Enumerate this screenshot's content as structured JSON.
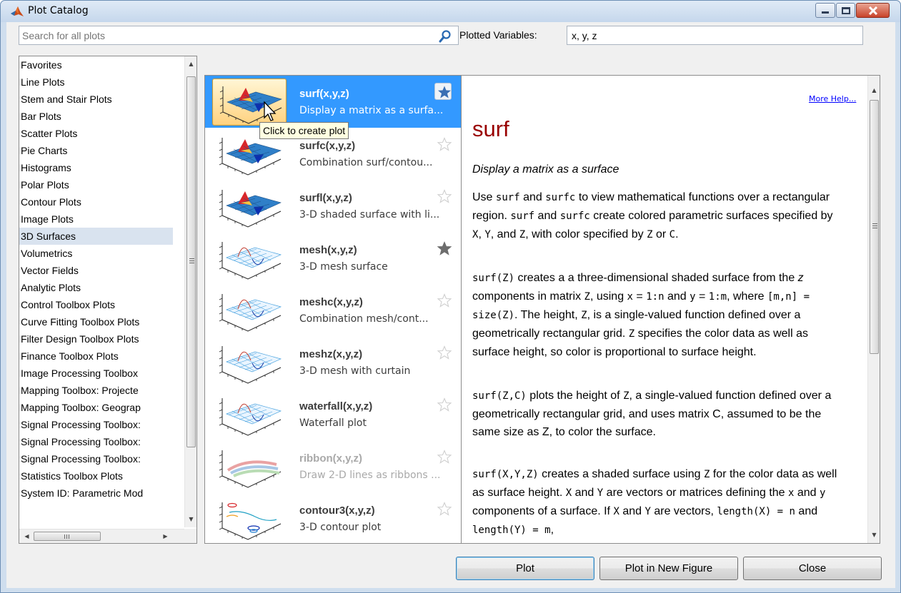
{
  "window": {
    "title": "Plot Catalog"
  },
  "search": {
    "placeholder": "Search for all plots"
  },
  "plotted_variables": {
    "label": "Plotted Variables:",
    "value": "x, y, z"
  },
  "categories": [
    "Favorites",
    "Line Plots",
    "Stem and Stair Plots",
    "Bar Plots",
    "Scatter Plots",
    "Pie Charts",
    "Histograms",
    "Polar Plots",
    "Contour Plots",
    "Image Plots",
    "3D Surfaces",
    "Volumetrics",
    "Vector Fields",
    "Analytic Plots",
    "Control Toolbox Plots",
    "Curve Fitting Toolbox Plots",
    "Filter Design Toolbox Plots",
    "Finance Toolbox Plots",
    "Image Processing Toolbox",
    "Mapping Toolbox: Projecte",
    "Mapping Toolbox: Geograp",
    "Signal Processing Toolbox:",
    "Signal Processing Toolbox:",
    "Signal Processing Toolbox:",
    "Statistics Toolbox Plots",
    "System ID: Parametric Mod"
  ],
  "selected_category": "3D Surfaces",
  "plots": [
    {
      "name": "surf(x,y,z)",
      "desc": "Display a matrix as a surfa...",
      "favorite": true,
      "selected": true,
      "dim": false,
      "thumb": "surface"
    },
    {
      "name": "surfc(x,y,z)",
      "desc": "Combination surf/contou...",
      "favorite": false,
      "selected": false,
      "dim": false,
      "thumb": "surface"
    },
    {
      "name": "surfl(x,y,z)",
      "desc": "3-D shaded surface with li...",
      "favorite": false,
      "selected": false,
      "dim": false,
      "thumb": "surface"
    },
    {
      "name": "mesh(x,y,z)",
      "desc": "3-D mesh surface",
      "favorite": true,
      "selected": false,
      "dim": false,
      "thumb": "mesh"
    },
    {
      "name": "meshc(x,y,z)",
      "desc": "Combination mesh/cont...",
      "favorite": false,
      "selected": false,
      "dim": false,
      "thumb": "mesh"
    },
    {
      "name": "meshz(x,y,z)",
      "desc": "3-D mesh with curtain",
      "favorite": false,
      "selected": false,
      "dim": false,
      "thumb": "mesh"
    },
    {
      "name": "waterfall(x,y,z)",
      "desc": "Waterfall plot",
      "favorite": false,
      "selected": false,
      "dim": false,
      "thumb": "mesh"
    },
    {
      "name": "ribbon(x,y,z)",
      "desc": "Draw 2-D lines as ribbons ...",
      "favorite": false,
      "selected": false,
      "dim": true,
      "thumb": "ribbon"
    },
    {
      "name": "contour3(x,y,z)",
      "desc": "3-D contour plot",
      "favorite": false,
      "selected": false,
      "dim": false,
      "thumb": "contour"
    }
  ],
  "tooltip": "Click to create plot",
  "doc": {
    "more_help": "More Help...",
    "title": "surf",
    "subtitle": "Display a matrix as a surface",
    "p1": [
      {
        "t": "Use "
      },
      {
        "c": "surf"
      },
      {
        "t": " and "
      },
      {
        "c": "surfc"
      },
      {
        "t": " to view mathematical functions over a rectangular region. "
      },
      {
        "c": "surf"
      },
      {
        "t": " and "
      },
      {
        "c": "surfc"
      },
      {
        "t": " create colored parametric surfaces specified by "
      },
      {
        "c": "X"
      },
      {
        "t": ", "
      },
      {
        "c": "Y"
      },
      {
        "t": ", and "
      },
      {
        "c": "Z"
      },
      {
        "t": ", with color specified by "
      },
      {
        "c": "Z"
      },
      {
        "t": " or "
      },
      {
        "c": "C"
      },
      {
        "t": "."
      }
    ],
    "p2": [
      {
        "c": "surf(Z)"
      },
      {
        "t": " creates a a three-dimensional shaded surface from the "
      },
      {
        "i": "z"
      },
      {
        "t": " components in matrix "
      },
      {
        "c": "Z"
      },
      {
        "t": ", using "
      },
      {
        "c": "x"
      },
      {
        "t": " = "
      },
      {
        "c": "1:n"
      },
      {
        "t": " and "
      },
      {
        "c": "y"
      },
      {
        "t": " = "
      },
      {
        "c": "1:m"
      },
      {
        "t": ", where "
      },
      {
        "c": "[m,n] = size(Z)"
      },
      {
        "t": ". The height, "
      },
      {
        "c": "Z"
      },
      {
        "t": ", is a single-valued function defined over a geometrically rectangular grid. "
      },
      {
        "c": "Z"
      },
      {
        "t": " specifies the color data as well as surface height, so color is proportional to surface height."
      }
    ],
    "p3": [
      {
        "c": "surf(Z,C)"
      },
      {
        "t": " plots the height of "
      },
      {
        "c": "Z"
      },
      {
        "t": ", a single-valued function defined over a geometrically rectangular grid, and uses matrix C, assumed to be the same size as Z, to color the surface."
      }
    ],
    "p4": [
      {
        "c": "surf(X,Y,Z)"
      },
      {
        "t": " creates a shaded surface using "
      },
      {
        "c": "Z"
      },
      {
        "t": " for the color data as well as surface height. "
      },
      {
        "c": "X"
      },
      {
        "t": " and "
      },
      {
        "c": "Y"
      },
      {
        "t": " are vectors or matrices defining the "
      },
      {
        "c": "x"
      },
      {
        "t": " and "
      },
      {
        "c": "y"
      },
      {
        "t": " components of a surface. If "
      },
      {
        "c": "X"
      },
      {
        "t": " and "
      },
      {
        "c": "Y"
      },
      {
        "t": " are vectors, "
      },
      {
        "c": "length(X) = n"
      },
      {
        "t": " and "
      },
      {
        "c": "length(Y) = m"
      },
      {
        "t": ","
      }
    ]
  },
  "buttons": {
    "plot": "Plot",
    "plot_new_figure": "Plot in New Figure",
    "close": "Close"
  }
}
